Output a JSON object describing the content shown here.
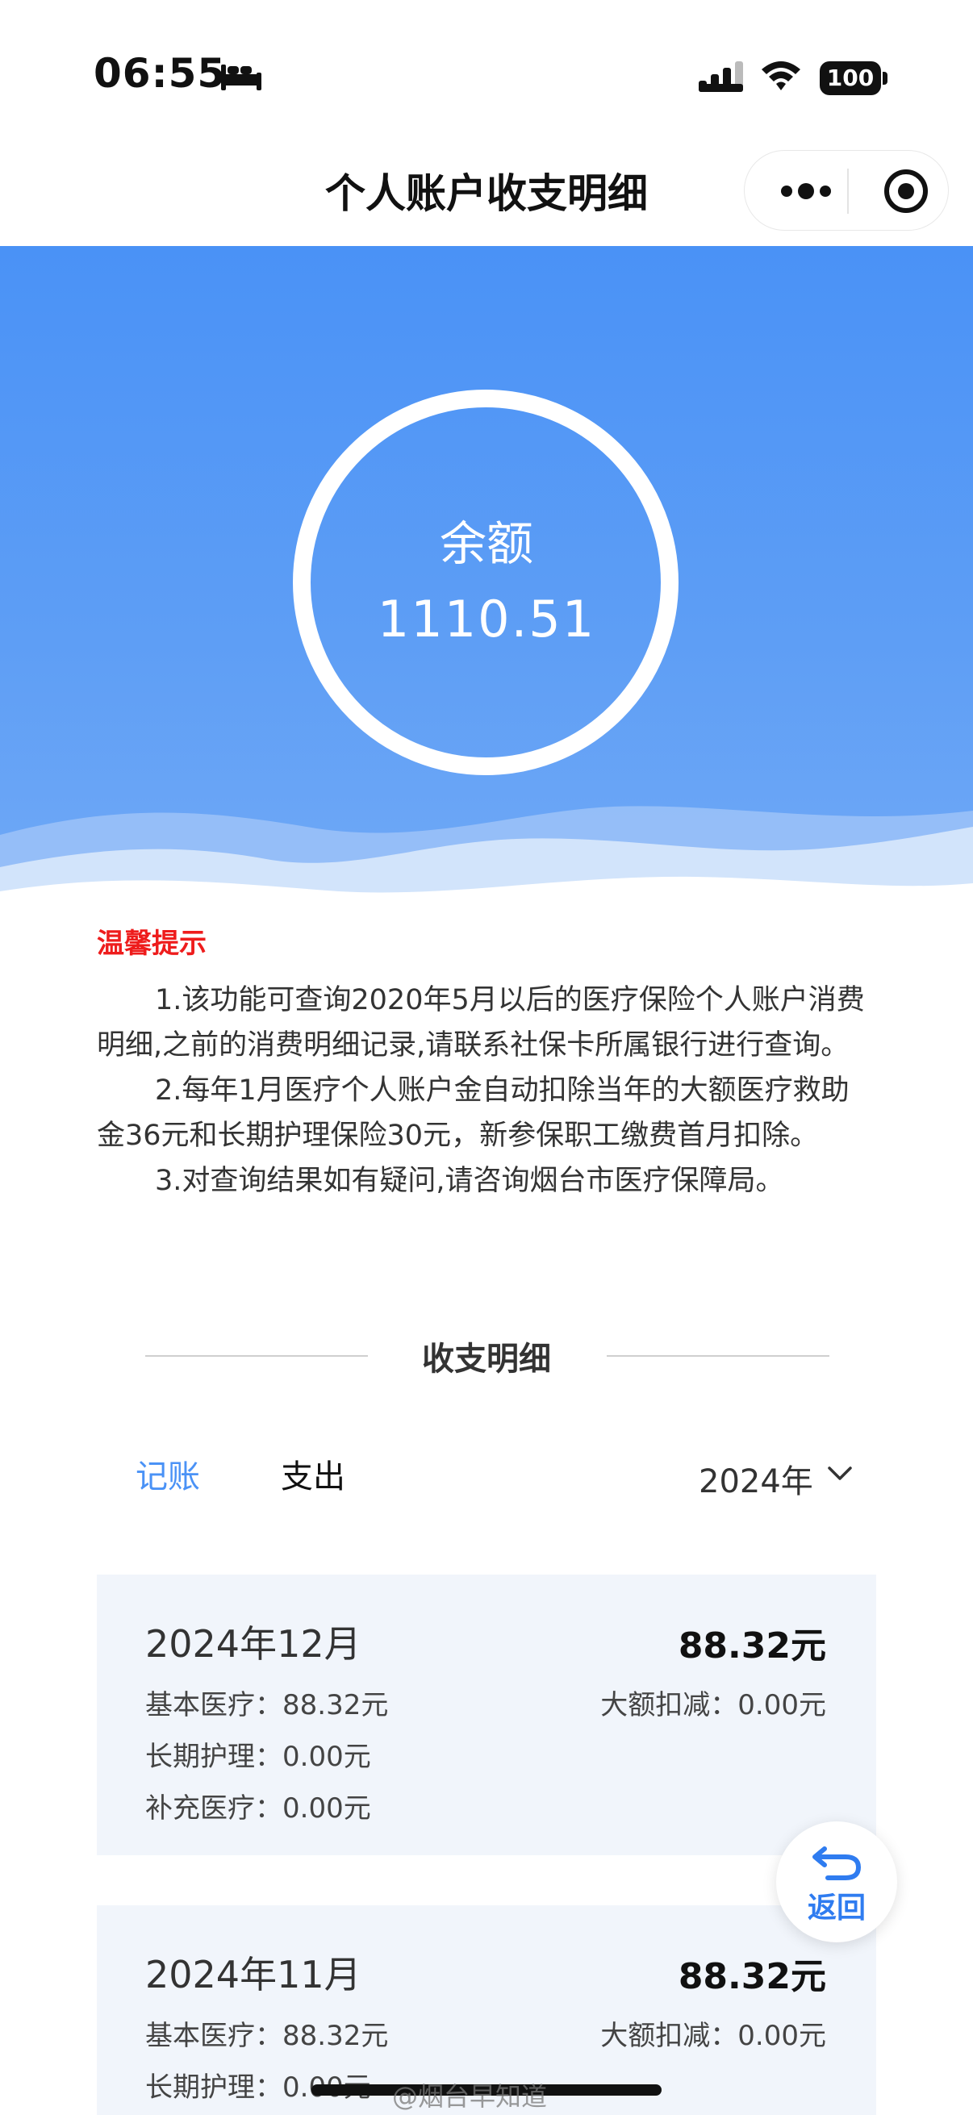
{
  "status_bar": {
    "time": "06:55",
    "battery": "100"
  },
  "nav": {
    "title": "个人账户收支明细"
  },
  "hero": {
    "balance_label": "余额",
    "balance_value": "1110.51"
  },
  "notice": {
    "title": "温馨提示",
    "items": [
      "1.该功能可查询2020年5月以后的医疗保险个人账户消费明细,之前的消费明细记录,请联系社保卡所属银行进行查询。",
      "2.每年1月医疗个人账户金自动扣除当年的大额医疗救助金36元和长期护理保险30元，新参保职工缴费首月扣除。",
      "3.对查询结果如有疑问,请咨询烟台市医疗保障局。"
    ]
  },
  "section": {
    "title": "收支明细"
  },
  "tabs": {
    "active": "记账",
    "other": "支出"
  },
  "year_select": "2024年",
  "cards": [
    {
      "month": "2024年12月",
      "total": "88.32元",
      "basic": "基本医疗：88.32元",
      "large": "大额扣减：0.00元",
      "longterm": "长期护理：0.00元",
      "supplement": "补充医疗：0.00元"
    },
    {
      "month": "2024年11月",
      "total": "88.32元",
      "basic": "基本医疗：88.32元",
      "large": "大额扣减：0.00元",
      "longterm": "长期护理：0.00元"
    }
  ],
  "back_button": "返回",
  "watermark": "@烟台早知道",
  "colors": {
    "accent": "#4a92f6",
    "notice_title": "#ee1c1c",
    "card_bg": "#f1f5fb"
  }
}
